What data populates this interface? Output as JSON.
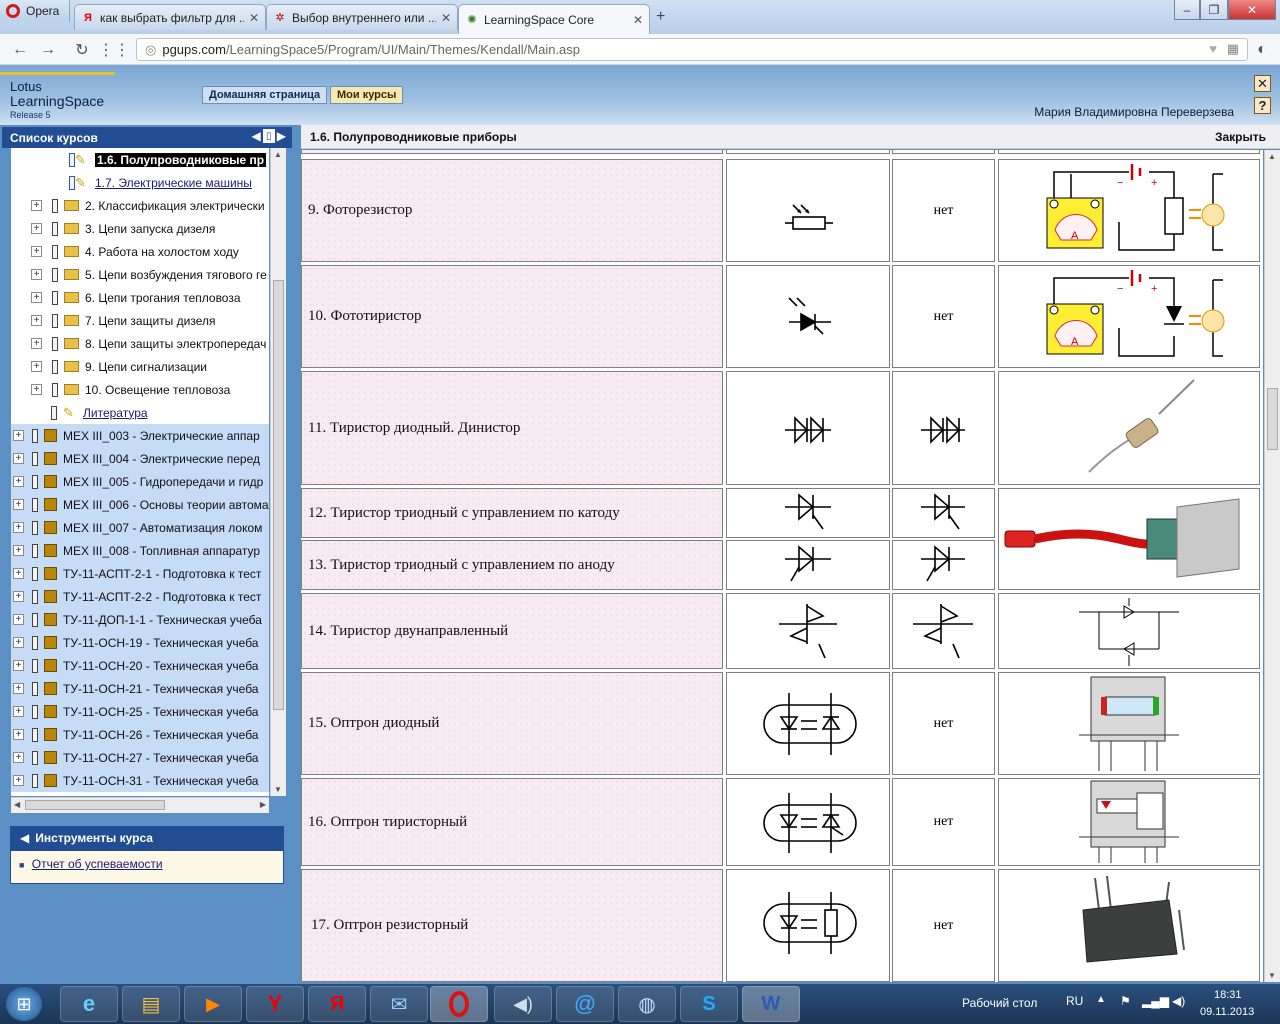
{
  "browser": {
    "opera_label": "Opera",
    "tabs": [
      {
        "label": "как выбрать фильтр для ...",
        "icon": "yandex-icon"
      },
      {
        "label": "Выбор внутреннего или ...",
        "icon": "butterfly-icon"
      },
      {
        "label": "LearningSpace Core",
        "icon": "learningspace-icon"
      }
    ],
    "url_host": "pgups.com",
    "url_path": "/LearningSpace5/Program/UI/Main/Themes/Kendall/Main.asp"
  },
  "app": {
    "logo": {
      "line1": "Lotus",
      "line2": "LearningSpace",
      "line3": "Release 5"
    },
    "nav": [
      "Домашняя страница",
      "Мои курсы"
    ],
    "user_name": "Мария Владимировна Переверзева"
  },
  "sidebar": {
    "title": "Список курсов",
    "items": [
      {
        "label": "1.6. Полупроводниковые пр",
        "type": "doc-active"
      },
      {
        "label": "1.7. Электрические машины",
        "type": "doc"
      },
      {
        "label": "2. Классификация электрически",
        "type": "folder"
      },
      {
        "label": "3. Цепи запуска дизеля",
        "type": "folder"
      },
      {
        "label": "4. Работа на холостом ходу",
        "type": "folder"
      },
      {
        "label": "5. Цепи возбуждения тягового ге",
        "type": "folder"
      },
      {
        "label": "6. Цепи трогания тепловоза",
        "type": "folder"
      },
      {
        "label": "7. Цепи защиты дизеля",
        "type": "folder"
      },
      {
        "label": "8. Цепи защиты электропередач",
        "type": "folder"
      },
      {
        "label": "9. Цепи сигнализации",
        "type": "folder"
      },
      {
        "label": "10. Освещение тепловоза",
        "type": "folder"
      },
      {
        "label": "Литература",
        "type": "lit"
      },
      {
        "label": "МЕХ III_003 - Электрические аппар",
        "type": "course"
      },
      {
        "label": "МЕХ III_004 - Электрические перед",
        "type": "course"
      },
      {
        "label": "МЕХ III_005 - Гидропередачи и гидр",
        "type": "course"
      },
      {
        "label": "МЕХ III_006 - Основы теории автомa",
        "type": "course"
      },
      {
        "label": "МЕХ III_007 - Автоматизация локом",
        "type": "course"
      },
      {
        "label": "МЕХ III_008 - Топливная аппаратур",
        "type": "course"
      },
      {
        "label": "ТУ-11-АСПТ-2-1 - Подготовка к тест",
        "type": "course"
      },
      {
        "label": "ТУ-11-АСПТ-2-2 - Подготовка к тест",
        "type": "course"
      },
      {
        "label": "ТУ-11-ДОП-1-1 - Техническая учеба",
        "type": "course"
      },
      {
        "label": "ТУ-11-ОСН-19 - Техническая учеба",
        "type": "course"
      },
      {
        "label": "ТУ-11-ОСН-20 - Техническая учеба",
        "type": "course"
      },
      {
        "label": "ТУ-11-ОСН-21 - Техническая учеба",
        "type": "course"
      },
      {
        "label": "ТУ-11-ОСН-25 - Техническая учеба",
        "type": "course"
      },
      {
        "label": "ТУ-11-ОСН-26 - Техническая учеба",
        "type": "course"
      },
      {
        "label": "ТУ-11-ОСН-27 - Техническая учеба",
        "type": "course"
      },
      {
        "label": "ТУ-11-ОСН-31 - Техническая учеба",
        "type": "course"
      }
    ],
    "tools_title": "Инструменты курса",
    "tools_link": "Отчет об успеваемости"
  },
  "content": {
    "title": "1.6. Полупроводниковые приборы",
    "close_label": "Закрыть",
    "rows": [
      {
        "name": "9. Фоторезистор",
        "alt": "нет"
      },
      {
        "name": "10. Фототиристор",
        "alt": "нет"
      },
      {
        "name": "11. Тиристор диодный. Динистор",
        "alt": ""
      },
      {
        "name": "12. Тиристор триодный с управлением по катоду",
        "alt": ""
      },
      {
        "name": "13. Тиристор триодный с управлением по аноду",
        "alt": ""
      },
      {
        "name": "14. Тиристор двунаправленный",
        "alt": ""
      },
      {
        "name": "15. Оптрон диодный",
        "alt": "нет"
      },
      {
        "name": "16. Оптрон тиристорный",
        "alt": "нет"
      },
      {
        "name": "17. Оптрон резисторный",
        "alt": "нет"
      }
    ]
  },
  "taskbar": {
    "desktop_label": "Рабочий стол",
    "lang": "RU",
    "time": "18:31",
    "date": "09.11.2013"
  }
}
